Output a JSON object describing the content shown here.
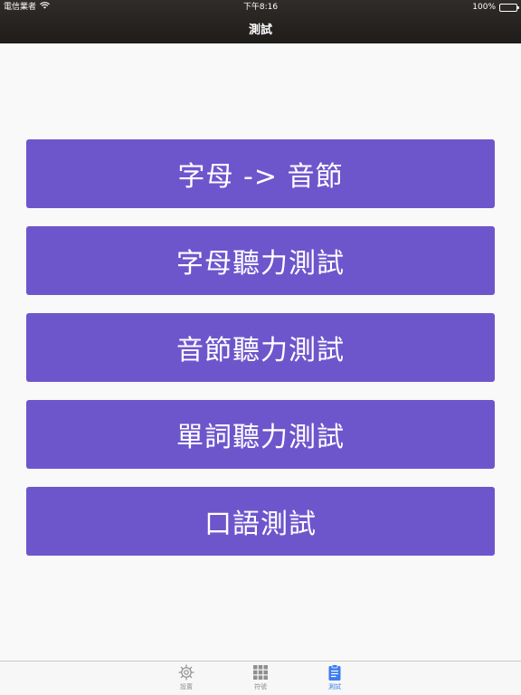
{
  "status_bar": {
    "carrier": "電信業者",
    "time": "下午8:16",
    "battery": "100%"
  },
  "nav": {
    "title": "測試"
  },
  "buttons": [
    {
      "label": "字母 -> 音節"
    },
    {
      "label": "字母聽力測試"
    },
    {
      "label": "音節聽力測試"
    },
    {
      "label": "單詞聽力測試"
    },
    {
      "label": "口語測試"
    }
  ],
  "tabs": [
    {
      "label": "設置",
      "icon": "gear-icon",
      "active": false
    },
    {
      "label": "符號",
      "icon": "grid-icon",
      "active": false
    },
    {
      "label": "測試",
      "icon": "clipboard-icon",
      "active": true
    }
  ],
  "colors": {
    "button_bg": "#6d56cc",
    "topbar_bg": "#2a2725",
    "tab_active": "#3d7cf0",
    "tab_inactive": "#8f8f8f"
  }
}
